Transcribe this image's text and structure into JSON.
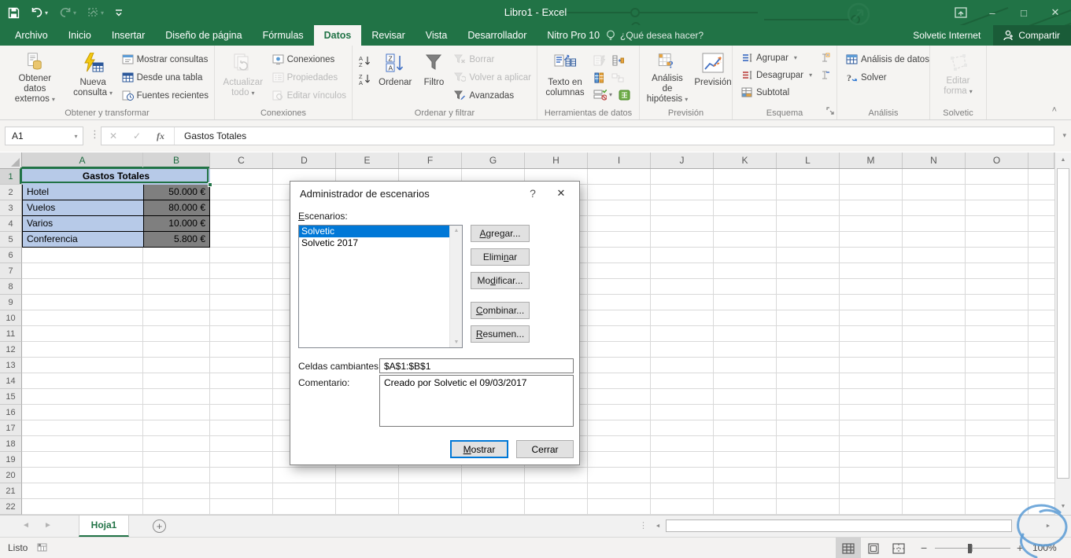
{
  "app": {
    "title": "Libro1 - Excel"
  },
  "icons": {
    "dropdown": "▾",
    "collapse": "˄",
    "close": "✕",
    "minimize": "–",
    "maximize": "□",
    "help": "?",
    "add_sheet": "+",
    "nav_left": "◄",
    "nav_right": "►",
    "dots": "⋮",
    "zoom_out": "−",
    "zoom_in": "+",
    "cancel": "✕",
    "enter": "✓",
    "fx": "fx",
    "expand": "▾",
    "scroll_up": "▲",
    "scroll_down": "▼",
    "scroll_left": "◄",
    "scroll_right": "►"
  },
  "colors": {
    "brand_green": "#217346",
    "selection_blue": "#0078d7",
    "cell_blue": "#b7cae8",
    "cell_gray": "#7f7f7f"
  },
  "tabs": {
    "items": [
      {
        "label": "Archivo",
        "active": false
      },
      {
        "label": "Inicio",
        "active": false
      },
      {
        "label": "Insertar",
        "active": false
      },
      {
        "label": "Diseño de página",
        "active": false
      },
      {
        "label": "Fórmulas",
        "active": false
      },
      {
        "label": "Datos",
        "active": true
      },
      {
        "label": "Revisar",
        "active": false
      },
      {
        "label": "Vista",
        "active": false
      },
      {
        "label": "Desarrollador",
        "active": false
      },
      {
        "label": "Nitro Pro 10",
        "active": false
      }
    ],
    "tell_me": "¿Qué desea hacer?",
    "account": "Solvetic Internet",
    "share": "Compartir"
  },
  "ribbon": {
    "get_external": "Obtener datos externos",
    "new_query": "Nueva consulta",
    "show_queries": "Mostrar consultas",
    "from_table": "Desde una tabla",
    "recent_sources": "Fuentes recientes",
    "g1": "Obtener y transformar",
    "refresh_all": "Actualizar todo",
    "connections": "Conexiones",
    "properties": "Propiedades",
    "edit_links": "Editar vínculos",
    "g2": "Conexiones",
    "sort": "Ordenar",
    "filter": "Filtro",
    "clear": "Borrar",
    "reapply": "Volver a aplicar",
    "advanced": "Avanzadas",
    "g3": "Ordenar y filtrar",
    "text_to_columns": "Texto en columnas",
    "g4": "Herramientas de datos",
    "what_if": "Análisis de hipótesis",
    "forecast_btn": "Previsión",
    "g5": "Previsión",
    "group": "Agrupar",
    "ungroup": "Desagrupar",
    "subtotal": "Subtotal",
    "g6": "Esquema",
    "data_analysis": "Análisis de datos",
    "solver": "Solver",
    "g7": "Análisis",
    "edit_shape": "Editar forma",
    "g8": "Solvetic"
  },
  "formula_bar": {
    "name_box": "A1",
    "value": "Gastos Totales"
  },
  "sheet": {
    "columns": [
      "A",
      "B",
      "C",
      "D",
      "E",
      "F",
      "G",
      "H",
      "I",
      "J",
      "K",
      "L",
      "M",
      "N",
      "O"
    ],
    "selected_columns": [
      "A",
      "B"
    ],
    "row_count": 22,
    "selected_rows": [
      1
    ],
    "header_cell": "Gastos Totales",
    "data": [
      {
        "label": "Hotel",
        "value": "50.000 €"
      },
      {
        "label": "Vuelos",
        "value": "80.000 €"
      },
      {
        "label": "Varios",
        "value": "10.000 €"
      },
      {
        "label": "Conferencia",
        "value": "5.800 €"
      }
    ]
  },
  "dialog": {
    "title": "Administrador de escenarios",
    "escenarios": {
      "label": "Escenarios:",
      "u": 0
    },
    "list": [
      {
        "label": "Solvetic",
        "selected": true
      },
      {
        "label": "Solvetic 2017",
        "selected": false
      }
    ],
    "side_buttons": [
      {
        "label": "Agregar...",
        "u": 0
      },
      {
        "label": "Eliminar",
        "u": 5
      },
      {
        "label": "Modificar...",
        "u": 2
      },
      {
        "label": "Combinar...",
        "u": 0
      },
      {
        "label": "Resumen...",
        "u": 0
      }
    ],
    "celdas_cambiantes": {
      "label": "Celdas cambiantes:",
      "value": "$A$1:$B$1"
    },
    "comentario": {
      "label": "Comentario:",
      "value": "Creado por Solvetic el 09/03/2017"
    },
    "mostrar": {
      "label": "Mostrar",
      "u": 0
    },
    "cerrar": {
      "label": "Cerrar",
      "u": -1
    }
  },
  "sheet_tabs": {
    "active": "Hoja1"
  },
  "status": {
    "ready": "Listo",
    "zoom_level": "100%"
  }
}
